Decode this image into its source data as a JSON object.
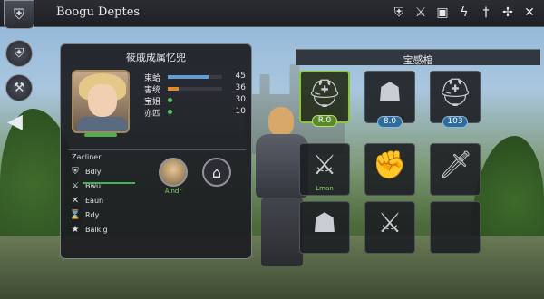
{
  "topbar": {
    "title": "Boogu Deptes",
    "icons": [
      "shield-icon",
      "sword-icon",
      "chest-icon",
      "lightning-icon",
      "dagger-icon",
      "crossed-swords-icon",
      "close-icon"
    ]
  },
  "character_panel": {
    "title": "筱戚成属忆兜",
    "stats": [
      {
        "label": "束蛤",
        "value": "45",
        "fill": 0.75,
        "kind": "bar-blue"
      },
      {
        "label": "害统",
        "value": "36",
        "fill": 0.2,
        "kind": "bar-orange"
      },
      {
        "label": "宝姐",
        "value": "30",
        "kind": "dot"
      },
      {
        "label": "亦匹",
        "value": "10",
        "kind": "dot"
      }
    ],
    "skills_label": "Zacliner",
    "skills": [
      {
        "label": "Bdly",
        "icon": "shield-icon"
      },
      {
        "label": "Bwu",
        "icon": "sword-icon"
      },
      {
        "label": "Eaun",
        "icon": "crossed-swords-icon"
      },
      {
        "label": "Rdy",
        "icon": "hourglass-icon"
      },
      {
        "label": "Balkig",
        "icon": "star-icon"
      }
    ],
    "mini_avatar_label": "Aindr"
  },
  "equipment": {
    "title": "宝感棺",
    "slots": [
      {
        "name": "helmet-knight-slot",
        "glyph": "⛑",
        "badge": "R.0",
        "badge_style": "green",
        "selected": true
      },
      {
        "name": "warrior-slot",
        "glyph": "☗",
        "badge": "8.0",
        "badge_style": "blue"
      },
      {
        "name": "helmet-slot",
        "glyph": "⛑",
        "badge": "103",
        "badge_style": "blue"
      },
      {
        "name": "sword-slot",
        "glyph": "⚔",
        "caption": "Lman"
      },
      {
        "name": "gauntlet-slot",
        "glyph": "✊"
      },
      {
        "name": "longsword-slot",
        "glyph": "🗡"
      },
      {
        "name": "soldier-slot",
        "glyph": "☗"
      },
      {
        "name": "dagger-slot",
        "glyph": "⚔"
      },
      {
        "name": "empty-slot",
        "glyph": ""
      }
    ]
  }
}
